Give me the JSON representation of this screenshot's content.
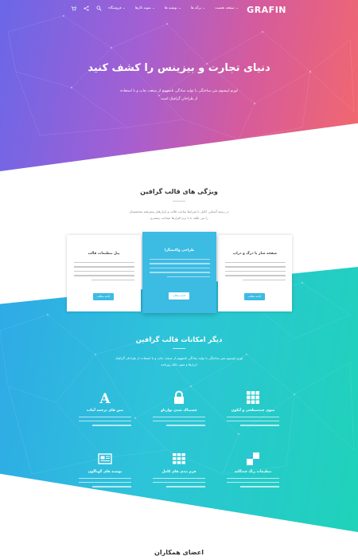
{
  "header": {
    "logo": "GRAFIN",
    "menu": [
      "صفحه نخست ⌄",
      "برگه ها ⌄",
      "نوشته ها ⌄",
      "نمونه کارها ⌄",
      "فروشگاه ⌄"
    ],
    "tools": {
      "search_icon": "search-icon",
      "share_icon": "share-icon",
      "cart_icon": "cart-icon"
    }
  },
  "hero": {
    "title": "دنیای تجارت و بیزینس را کشف کنید",
    "subtitle_line1": "لورم ایپسوم متن ساختگی با تولید سادگی نامفهوم از صنعت چاپ و با استفاده",
    "subtitle_line2": "از طراحان گرافیک است"
  },
  "features": {
    "title": "ویژگی های قالب گرافین",
    "desc_line1": "در زمینه آشنایی کامل با شرایط ساخت قالب و ابزارهای پیشرفته متخصصان",
    "desc_line2": "را می طلبد تا با نرم افزارها شناخت بیشتری",
    "cards": [
      {
        "title": "صفحه ساز با درگ و دراپ",
        "button": "ادامه مطلب"
      },
      {
        "title": "طراحی واکنشگرا",
        "button": "ادامه مطلب"
      },
      {
        "title": "پنل تنظیمات قالب",
        "button": "ادامه مطلب"
      }
    ]
  },
  "other": {
    "title": "دیگر امکانات قالب گرافین",
    "sub_line1": "لورم ایپسوم متن ساختگی با تولید سادگی نامفهوم از صنعت چاپ و با استفاده از طراحان گرافیک",
    "sub_line2": "ابزارها و متون بلکه روزنامه",
    "items": [
      {
        "title": "منوی چندسطحی و آیکون",
        "icon": "grid-icon"
      },
      {
        "title": "چسبناک شدن نوارناو",
        "icon": "lock-icon"
      },
      {
        "title": "متن های ترجمه آماده",
        "icon": "font-icon"
      },
      {
        "title": "تنظیمات رنگ چندگانه",
        "icon": "color-palette-icon"
      },
      {
        "title": "نوشته های گوناگون",
        "icon": "newspaper-icon"
      },
      {
        "title": "فرم بندی های کامل",
        "icon": "blocks-icon"
      }
    ]
  },
  "team": {
    "title": "اعضای همکاران"
  },
  "colors": {
    "hero_gradient": [
      "#6a67e8",
      "#a35fd3",
      "#d65b9c",
      "#f2686d"
    ],
    "accent": "#3cbbe3",
    "band_gradient": [
      "#2fa9e6",
      "#2dc4d9",
      "#1fd2b9"
    ]
  }
}
